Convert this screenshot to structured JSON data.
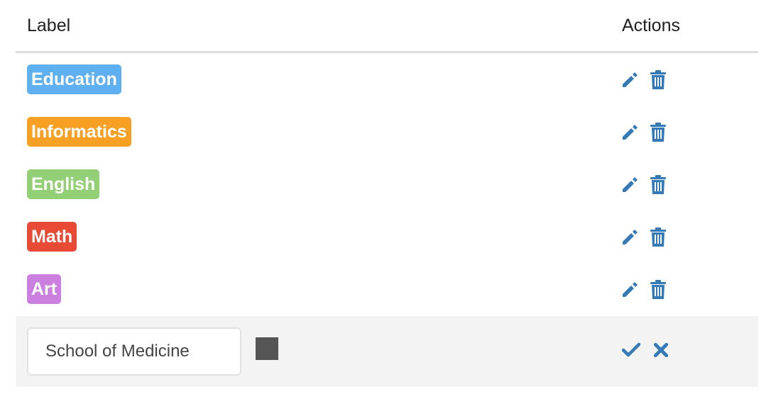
{
  "table": {
    "headers": {
      "label": "Label",
      "actions": "Actions"
    },
    "rows": [
      {
        "label": "Education",
        "color": "#5eb0f0"
      },
      {
        "label": "Informatics",
        "color": "#f8a024"
      },
      {
        "label": "English",
        "color": "#93cf74"
      },
      {
        "label": "Math",
        "color": "#e84a36"
      },
      {
        "label": "Art",
        "color": "#cb80e0"
      }
    ],
    "row_actions": {
      "edit_icon": "pencil-icon",
      "delete_icon": "trash-icon"
    },
    "icon_color": "#337ab7"
  },
  "edit_row": {
    "name_value": "School of Medicine",
    "swatch_color": "#555555",
    "save_icon": "check-icon",
    "cancel_icon": "close-icon"
  }
}
